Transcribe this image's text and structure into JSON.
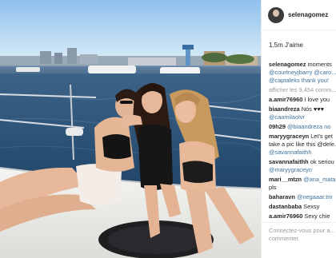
{
  "header": {
    "username": "selenagomez"
  },
  "likes": "1.5m J'aime",
  "caption": {
    "user": "selenagomez",
    "text": "moments",
    "line2": "@courtneyjbarry @caro...",
    "line3": "@captaleks thank you!"
  },
  "view_more": "afficher les 9,454 comm...",
  "comments": [
    {
      "user": "a.amir76960",
      "text": "I love you"
    },
    {
      "user": "biaandreza",
      "text": "Nós ♥♥♥",
      "cont": "@caamilaolvr"
    },
    {
      "user": "09h29",
      "text": "@biaandreza no"
    },
    {
      "user": "maryygraceyn",
      "text": "Let's get",
      "cont": "take a pic like this @dele..."
    },
    {
      "user": "",
      "text": "",
      "cont": "@savannafaithh"
    },
    {
      "user": "savannafaithh",
      "text": "ok seriou",
      "cont": "@maryygraceyn"
    },
    {
      "user": "mari__mtzn",
      "text": "@ana_mata",
      "cont": "pls"
    },
    {
      "user": "baharavn",
      "text": "@negaaar.tm"
    },
    {
      "user": "dastanbaba",
      "text": "Sexsy"
    },
    {
      "user": "a.amir76960",
      "text": "Sexy chie"
    }
  ],
  "login_hint": "Connectez-vous pour a... commenter.",
  "icons": {
    "avatar": "profile-avatar"
  }
}
